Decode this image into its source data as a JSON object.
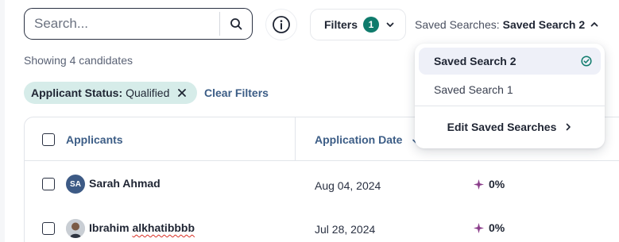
{
  "search": {
    "placeholder": "Search...",
    "value": ""
  },
  "toolbar": {
    "filters_label": "Filters",
    "filters_count": "1",
    "saved_prefix": "Saved Searches:",
    "saved_current": "Saved Search 2"
  },
  "results": {
    "showing_text": "Showing 4 candidates"
  },
  "active_filter": {
    "key": "Applicant Status:",
    "value": "Qualified"
  },
  "clear_filters_label": "Clear Filters",
  "table": {
    "columns": {
      "applicants": "Applicants",
      "application_date": "Application Date"
    },
    "rows": [
      {
        "initials": "SA",
        "name": "Sarah Ahmad",
        "name_misspelled": "",
        "date": "Aug 04, 2024",
        "score": "0%",
        "avatar_type": "initials"
      },
      {
        "initials": "",
        "name": "Ibrahim ",
        "name_misspelled": "alkhatibbbb",
        "date": "Jul 28, 2024",
        "score": "0%",
        "avatar_type": "photo"
      }
    ]
  },
  "saved_dropdown": {
    "items": [
      {
        "label": "Saved Search 2",
        "selected": true
      },
      {
        "label": "Saved Search 1",
        "selected": false
      }
    ],
    "edit_label": "Edit Saved Searches"
  },
  "colors": {
    "accent_teal": "#0f7b6c",
    "link_blue": "#3c5d86",
    "chip_bg": "#d6ece9",
    "score_star": "#8a3d8a"
  }
}
